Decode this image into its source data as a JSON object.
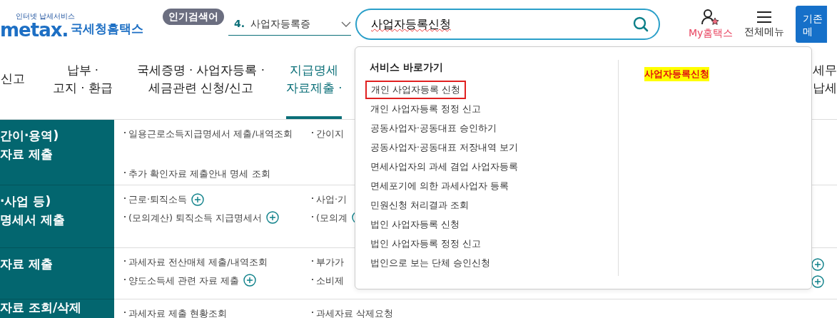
{
  "header": {
    "logo": {
      "tagline": "인터넷 납세서비스",
      "wordmark": "metax.",
      "name": "국세청홈택스"
    },
    "popular": {
      "label": "인기검색어",
      "rank": "4.",
      "term": "사업자등록증"
    },
    "search": {
      "value": "사업자등록신청"
    },
    "actions": [
      {
        "kind": "my",
        "label": "My홈택스"
      },
      {
        "kind": "menu",
        "label": "전체메뉴"
      }
    ],
    "classic_button": {
      "lines": [
        "기존",
        "메"
      ]
    }
  },
  "nav": [
    {
      "lines": [
        "신고"
      ],
      "selected": false
    },
    {
      "lines": [
        "납부 ·",
        "고지 · 환급"
      ],
      "selected": false
    },
    {
      "lines": [
        "국세증명 · 사업자등록 ·",
        "세금관련 신청/신고"
      ],
      "selected": false
    },
    {
      "lines": [
        "지급명세",
        "자료제출 ·"
      ],
      "selected": true
    },
    {
      "lines": [
        "세무",
        "납세"
      ],
      "selected": false
    }
  ],
  "sections": [
    {
      "title": [
        "간이·용역)",
        "자료 제출"
      ],
      "columns": [
        [
          {
            "label": "일용근로소득지급명세서 제출/내역조회",
            "expandable": false
          },
          {
            "label": "추가 확인자료 제출안내 명세 조회",
            "expandable": false
          }
        ],
        [
          {
            "label": "간이지",
            "expandable": false
          }
        ],
        []
      ]
    },
    {
      "title": [
        "·사업 등)",
        "명세서 제출"
      ],
      "columns": [
        [
          {
            "label": "근로·퇴직소득",
            "expandable": true
          },
          {
            "label": "(모의계산) 퇴직소득 지급명세서",
            "expandable": true
          }
        ],
        [
          {
            "label": "사업·기",
            "expandable": false
          },
          {
            "label": "(모의계",
            "expandable": true
          }
        ],
        []
      ]
    },
    {
      "title": [
        "자료 제출"
      ],
      "columns": [
        [
          {
            "label": "과세자료 전산매체 제출/내역조회",
            "expandable": false
          },
          {
            "label": "양도소득세 관련 자료 제출",
            "expandable": true
          }
        ],
        [
          {
            "label": "부가가",
            "expandable": false
          },
          {
            "label": "소비제",
            "expandable": false
          }
        ],
        [
          {
            "expandable": true
          },
          {
            "expandable": true
          }
        ]
      ]
    },
    {
      "title": [
        "자료 조회/삭제"
      ],
      "columns": [
        [
          {
            "label": "과세자료 제출 현황조회",
            "expandable": false
          }
        ],
        [
          {
            "label": "과세자료 삭제요청",
            "expandable": false
          }
        ],
        []
      ]
    }
  ],
  "dropdown": {
    "title": "서비스 바로가기",
    "items": [
      {
        "label": "개인 사업자등록 신청",
        "selected": true
      },
      {
        "label": "개인 사업자등록 정정 신고",
        "selected": false
      },
      {
        "label": "공동사업자·공동대표 승인하기",
        "selected": false
      },
      {
        "label": "공동사업자·공동대표 저장내역 보기",
        "selected": false
      },
      {
        "label": "면세사업자의 과세 겸업 사업자등록",
        "selected": false
      },
      {
        "label": "면세포기에 의한 과세사업자 등록",
        "selected": false
      },
      {
        "label": "민원신청 처리결과 조회",
        "selected": false
      },
      {
        "label": "법인 사업자등록 신청",
        "selected": false
      },
      {
        "label": "법인 사업자등록 정정 신고",
        "selected": false
      },
      {
        "label": "법인으로 보는 단체 승인신청",
        "selected": false
      }
    ],
    "suggestions": [
      "사업자등록신청"
    ]
  }
}
